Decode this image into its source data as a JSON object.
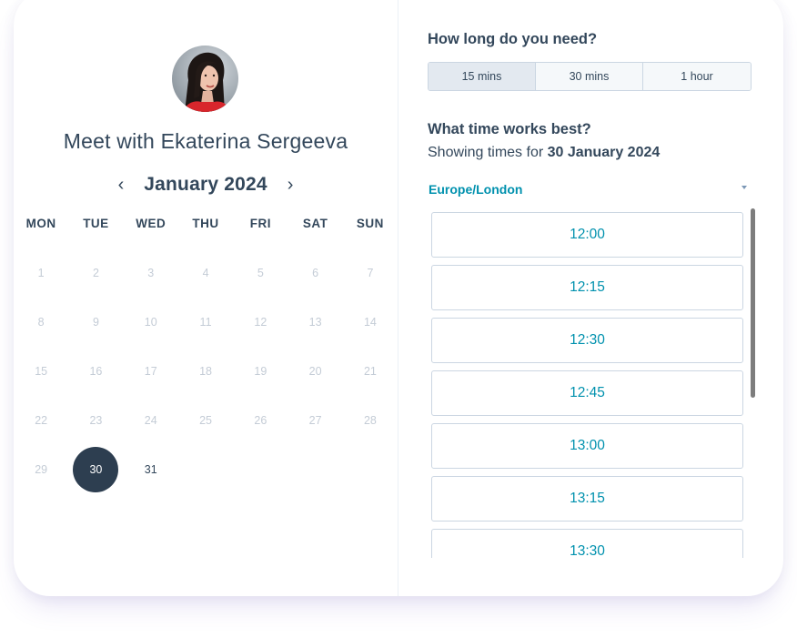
{
  "host": {
    "title": "Meet with Ekaterina Sergeeva",
    "avatar_icon": "profile-photo"
  },
  "calendar": {
    "month_label": "January 2024",
    "prev_icon": "‹",
    "next_icon": "›",
    "weekdays": [
      "MON",
      "TUE",
      "WED",
      "THU",
      "FRI",
      "SAT",
      "SUN"
    ],
    "weeks": [
      [
        "1",
        "2",
        "3",
        "4",
        "5",
        "6",
        "7"
      ],
      [
        "8",
        "9",
        "10",
        "11",
        "12",
        "13",
        "14"
      ],
      [
        "15",
        "16",
        "17",
        "18",
        "19",
        "20",
        "21"
      ],
      [
        "22",
        "23",
        "24",
        "25",
        "26",
        "27",
        "28"
      ],
      [
        "29",
        "30",
        "31",
        "",
        "",
        "",
        ""
      ]
    ],
    "selected_day": "30",
    "available_days": [
      "30",
      "31"
    ]
  },
  "duration": {
    "question": "How long do you need?",
    "options": [
      "15 mins",
      "30 mins",
      "1 hour"
    ],
    "selected": "15 mins"
  },
  "times": {
    "question": "What time works best?",
    "showing_prefix": "Showing times for ",
    "showing_date": "30 January 2024",
    "timezone": "Europe/London",
    "slots": [
      "12:00",
      "12:15",
      "12:30",
      "12:45",
      "13:00",
      "13:15",
      "13:30"
    ]
  },
  "colors": {
    "accent": "#0091ae",
    "text": "#33475b",
    "selected_day_bg": "#2d3e50"
  }
}
